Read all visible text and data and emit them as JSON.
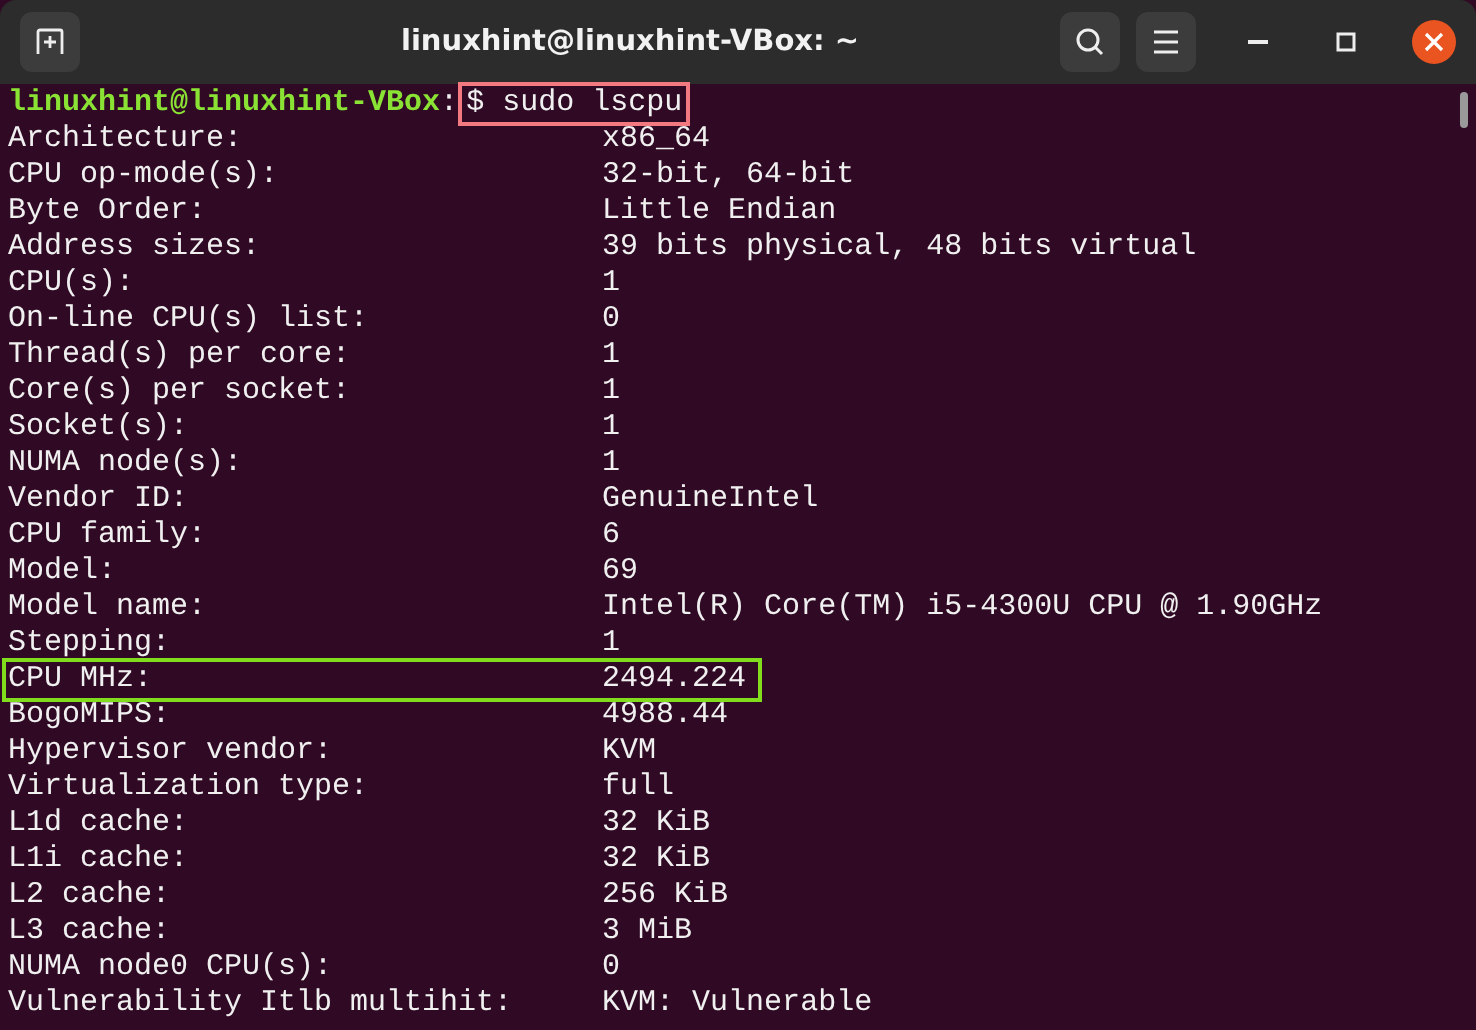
{
  "window": {
    "title": "linuxhint@linuxhint-VBox: ~"
  },
  "prompt": {
    "user_host": "linuxhint@linuxhint-VBox",
    "separator": ":",
    "command": "$ sudo lscpu",
    "highlighted": true
  },
  "rows": [
    {
      "label": "Architecture:",
      "value": "x86_64",
      "highlighted": false
    },
    {
      "label": "CPU op-mode(s):",
      "value": "32-bit, 64-bit",
      "highlighted": false
    },
    {
      "label": "Byte Order:",
      "value": "Little Endian",
      "highlighted": false
    },
    {
      "label": "Address sizes:",
      "value": "39 bits physical, 48 bits virtual",
      "highlighted": false
    },
    {
      "label": "CPU(s):",
      "value": "1",
      "highlighted": false
    },
    {
      "label": "On-line CPU(s) list:",
      "value": "0",
      "highlighted": false
    },
    {
      "label": "Thread(s) per core:",
      "value": "1",
      "highlighted": false
    },
    {
      "label": "Core(s) per socket:",
      "value": "1",
      "highlighted": false
    },
    {
      "label": "Socket(s):",
      "value": "1",
      "highlighted": false
    },
    {
      "label": "NUMA node(s):",
      "value": "1",
      "highlighted": false
    },
    {
      "label": "Vendor ID:",
      "value": "GenuineIntel",
      "highlighted": false
    },
    {
      "label": "CPU family:",
      "value": "6",
      "highlighted": false
    },
    {
      "label": "Model:",
      "value": "69",
      "highlighted": false
    },
    {
      "label": "Model name:",
      "value": "Intel(R) Core(TM) i5-4300U CPU @ 1.90GHz",
      "highlighted": false
    },
    {
      "label": "Stepping:",
      "value": "1",
      "highlighted": false
    },
    {
      "label": "CPU MHz:",
      "value": "2494.224",
      "highlighted": true
    },
    {
      "label": "BogoMIPS:",
      "value": "4988.44",
      "highlighted": false
    },
    {
      "label": "Hypervisor vendor:",
      "value": "KVM",
      "highlighted": false
    },
    {
      "label": "Virtualization type:",
      "value": "full",
      "highlighted": false
    },
    {
      "label": "L1d cache:",
      "value": "32 KiB",
      "highlighted": false
    },
    {
      "label": "L1i cache:",
      "value": "32 KiB",
      "highlighted": false
    },
    {
      "label": "L2 cache:",
      "value": "256 KiB",
      "highlighted": false
    },
    {
      "label": "L3 cache:",
      "value": "3 MiB",
      "highlighted": false
    },
    {
      "label": "NUMA node0 CPU(s):",
      "value": "0",
      "highlighted": false
    },
    {
      "label": "Vulnerability Itlb multihit:",
      "value": "KVM: Vulnerable",
      "highlighted": false
    }
  ]
}
